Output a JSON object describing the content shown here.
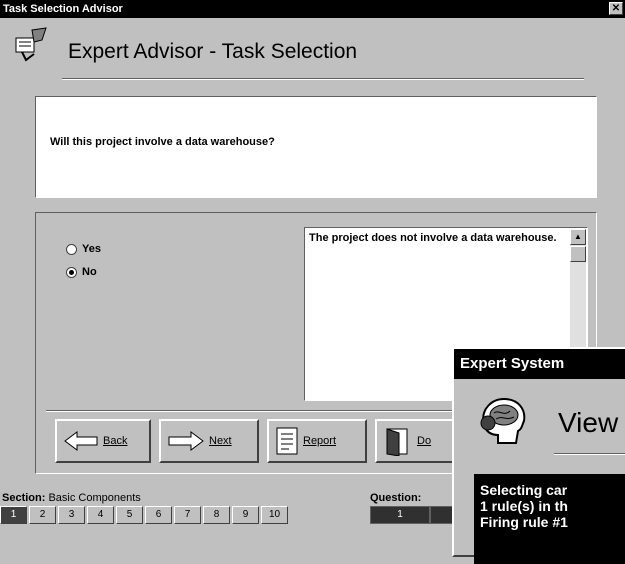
{
  "window": {
    "title": "Task Selection Advisor",
    "close_glyph": "✕"
  },
  "header": {
    "title": "Expert Advisor - Task Selection"
  },
  "question": {
    "text": "Will this project involve a data warehouse?"
  },
  "answers": {
    "options": [
      {
        "label": "Yes",
        "selected": false
      },
      {
        "label": "No",
        "selected": true
      }
    ],
    "explanation": "The project does not involve a data warehouse."
  },
  "nav_buttons": [
    {
      "label": "Back",
      "icon": "back-arrow-icon"
    },
    {
      "label": "Next",
      "icon": "next-arrow-icon"
    },
    {
      "label": "Report",
      "icon": "report-icon"
    },
    {
      "label": "Do",
      "icon": "door-icon"
    }
  ],
  "statusbar": {
    "section_label": "Section:",
    "section_value": "Basic Components",
    "question_label": "Question:",
    "section_tabs": [
      "1",
      "2",
      "3",
      "4",
      "5",
      "6",
      "7",
      "8",
      "9",
      "10"
    ],
    "active_section": "1",
    "question_tabs": [
      "1",
      ""
    ]
  },
  "overlay": {
    "title": "Expert System",
    "view_label": "View",
    "lines": [
      "Selecting car",
      "1 rule(s) in th",
      "Firing rule #1"
    ]
  }
}
